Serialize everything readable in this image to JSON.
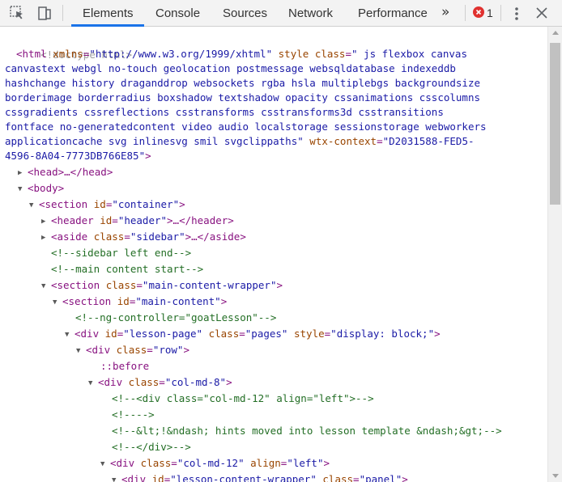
{
  "toolbar": {
    "inspect_icon": "inspect-element-icon",
    "device_icon": "device-toolbar-icon",
    "tabs": [
      {
        "label": "Elements",
        "active": true
      },
      {
        "label": "Console"
      },
      {
        "label": "Sources"
      },
      {
        "label": "Network"
      },
      {
        "label": "Performance"
      }
    ],
    "more_tabs_label": "»",
    "error_count": "1",
    "error_icon": "error-circle-icon",
    "menu_icon": "kebab-menu-icon",
    "close_icon": "close-icon",
    "accent_color": "#1a73e8",
    "error_color": "#e0312f"
  },
  "dom": {
    "doctype": "<!doctype html>",
    "html_open": {
      "tag_open": "<html",
      "attr1_name": "xmlns",
      "attr1_value": "\"http://www.w3.org/1999/xhtml\"",
      "attr2_name": "style",
      "attr3_name": "class",
      "attr3_value_start": "\" js flexbox canvas",
      "class_lines": [
        "canvastext webgl no-touch geolocation postmessage websqldatabase indexeddb",
        "hashchange history draganddrop websockets rgba hsla multiplebgs backgroundsize",
        "borderimage borderradius boxshadow textshadow opacity cssanimations csscolumns",
        "cssgradients cssreflections csstransforms csstransforms3d csstransitions",
        "fontface no-generatedcontent video audio localstorage sessionstorage webworkers"
      ],
      "class_last": "applicationcache svg inlinesvg smil svgclippaths\"",
      "attr4_name": "wtx-context",
      "attr4_value_a": "\"D2031588-FED5-",
      "attr4_value_b": "4596-8A04-7773DB766E85\"",
      "tag_close": ">"
    },
    "nodes": [
      {
        "name": "head",
        "text": "<head>…</head>"
      },
      {
        "name": "body",
        "text": "<body>"
      },
      {
        "name": "section-container",
        "tag": "<section",
        "an": "id",
        "av": "\"container\"",
        "end": ">"
      },
      {
        "name": "header",
        "tag": "<header",
        "an": "id",
        "av": "\"header\"",
        "end": ">…</header>"
      },
      {
        "name": "aside",
        "tag": "<aside",
        "an": "class",
        "av": "\"sidebar\"",
        "end": ">…</aside>"
      },
      {
        "name": "comment-sidebar-end",
        "text": "<!--sidebar left end-->"
      },
      {
        "name": "comment-main-start",
        "text": "<!--main content start-->"
      },
      {
        "name": "section-main-content-wrapper",
        "tag": "<section",
        "an": "class",
        "av": "\"main-content-wrapper\"",
        "end": ">"
      },
      {
        "name": "section-main-content",
        "tag": "<section",
        "an": "id",
        "av": "\"main-content\"",
        "end": ">"
      },
      {
        "name": "comment-ng-controller",
        "text": "<!--ng-controller=\"goatLesson\"-->"
      },
      {
        "name": "div-lesson-page",
        "tag": "<div",
        "an": "id",
        "av": "\"lesson-page\"",
        "an2": "class",
        "av2": "\"pages\"",
        "an3": "style",
        "av3": "\"display: block;\"",
        "end": ">"
      },
      {
        "name": "div-row",
        "tag": "<div",
        "an": "class",
        "av": "\"row\"",
        "end": ">"
      },
      {
        "name": "pseudo-before",
        "text": "::before"
      },
      {
        "name": "div-col-md-8",
        "tag": "<div",
        "an": "class",
        "av": "\"col-md-8\"",
        "end": ">"
      },
      {
        "name": "comment-col-md-12",
        "text": "<!--<div class=\"col-md-12\" align=\"left\">-->"
      },
      {
        "name": "comment-empty",
        "text": "<!---->"
      },
      {
        "name": "comment-hints",
        "text": "<!--&lt;!&ndash; hints moved into lesson template &ndash;&gt;-->"
      },
      {
        "name": "comment-div-close",
        "text": "<!--</div>-->"
      },
      {
        "name": "div-col-md-12",
        "tag": "<div",
        "an": "class",
        "av": "\"col-md-12\"",
        "an2": "align",
        "av2": "\"left\"",
        "end": ">"
      },
      {
        "name": "div-lesson-content-wrapper",
        "tag": "<div",
        "an": "id",
        "av": "\"lesson-content-wrapper\"",
        "an2": "class",
        "av2": "\"panel\"",
        "end": ">"
      }
    ]
  }
}
